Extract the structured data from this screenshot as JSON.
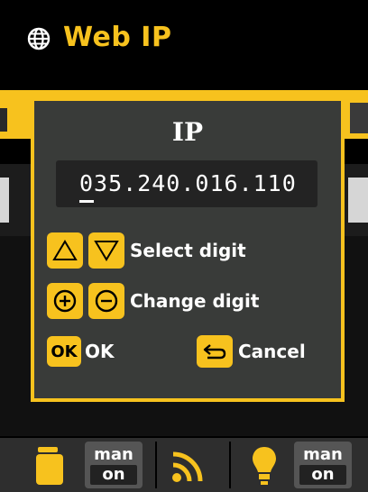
{
  "header": {
    "title": "Web IP",
    "icon": "globe-icon"
  },
  "dialog": {
    "title": "IP",
    "ip_value": "035.240.016.110",
    "hints": {
      "select_digit": "Select digit",
      "change_digit": "Change digit",
      "ok_key": "OK",
      "ok": "OK",
      "cancel": "Cancel"
    }
  },
  "bottom_bar": {
    "left_status": {
      "top": "man",
      "bottom": "on"
    },
    "right_status": {
      "top": "man",
      "bottom": "on"
    },
    "icons": [
      "lamp-icon",
      "wifi-icon",
      "bulb-icon"
    ]
  },
  "colors": {
    "accent": "#f7c21e",
    "dialog_bg": "#393b39",
    "field_bg": "#232323"
  }
}
